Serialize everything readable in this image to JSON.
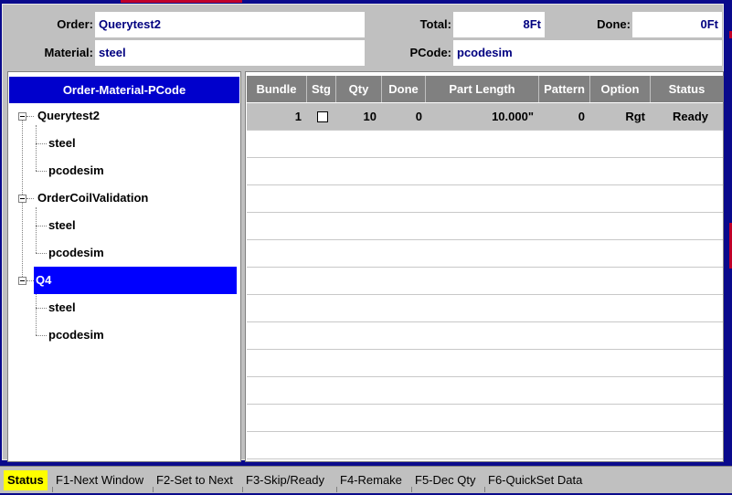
{
  "header": {
    "order_label": "Order:",
    "order_value": "Querytest2",
    "material_label": "Material:",
    "material_value": "steel",
    "total_label": "Total:",
    "total_value": "8Ft",
    "done_label": "Done:",
    "done_value": "0Ft",
    "pcode_label": "PCode:",
    "pcode_value": "pcodesim"
  },
  "tree": {
    "header": "Order-Material-PCode",
    "orders": [
      {
        "name": "Querytest2",
        "children": [
          "steel",
          "pcodesim"
        ],
        "selected": false
      },
      {
        "name": "OrderCoilValidation",
        "children": [
          "steel",
          "pcodesim"
        ],
        "selected": false
      },
      {
        "name": "Q4",
        "children": [
          "steel",
          "pcodesim"
        ],
        "selected": true
      }
    ]
  },
  "table": {
    "columns": [
      "Bundle",
      "Stg",
      "Qty",
      "Done",
      "Part Length",
      "Pattern",
      "Option",
      "Status"
    ],
    "rows": [
      {
        "bundle": "1",
        "stg": false,
        "qty": "10",
        "done": "0",
        "part_length": "10.000\"",
        "pattern": "0",
        "option": "Rgt",
        "status": "Ready"
      }
    ]
  },
  "statusbar": {
    "status": "Status",
    "f1": "F1-Next Window",
    "f2": "F2-Set to Next",
    "f3": "F3-Skip/Ready",
    "f4": "F4-Remake",
    "f5": "F5-Dec Qty",
    "f6": "F6-QuickSet Data"
  },
  "colors": {
    "selection": "#0000ff",
    "tree_header": "#0000cc",
    "status_highlight": "#ffff00",
    "value_text": "#000080"
  }
}
